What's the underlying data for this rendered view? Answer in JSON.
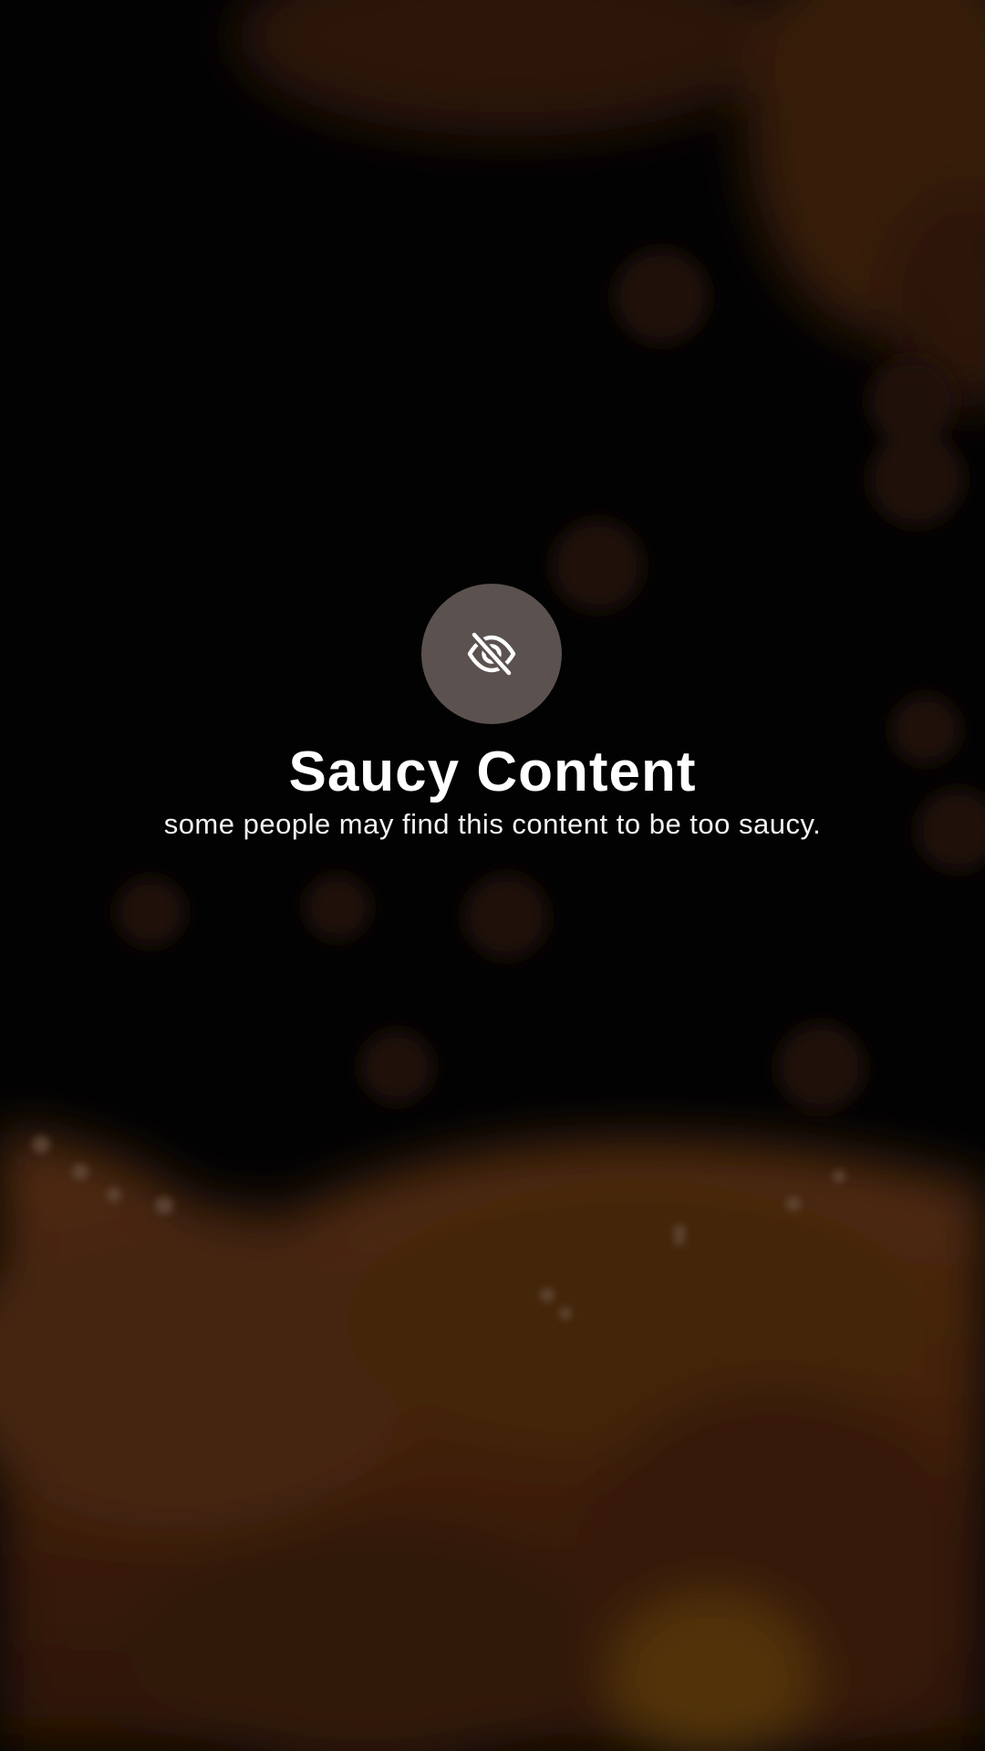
{
  "warning": {
    "icon": "eye-slash-icon",
    "title": "Saucy Content",
    "message": "some people may find this content to be too saucy."
  },
  "colors": {
    "background": "#030304",
    "icon_circle": "#5b5250",
    "text": "#ffffff",
    "food_tint": "#6a3510"
  }
}
